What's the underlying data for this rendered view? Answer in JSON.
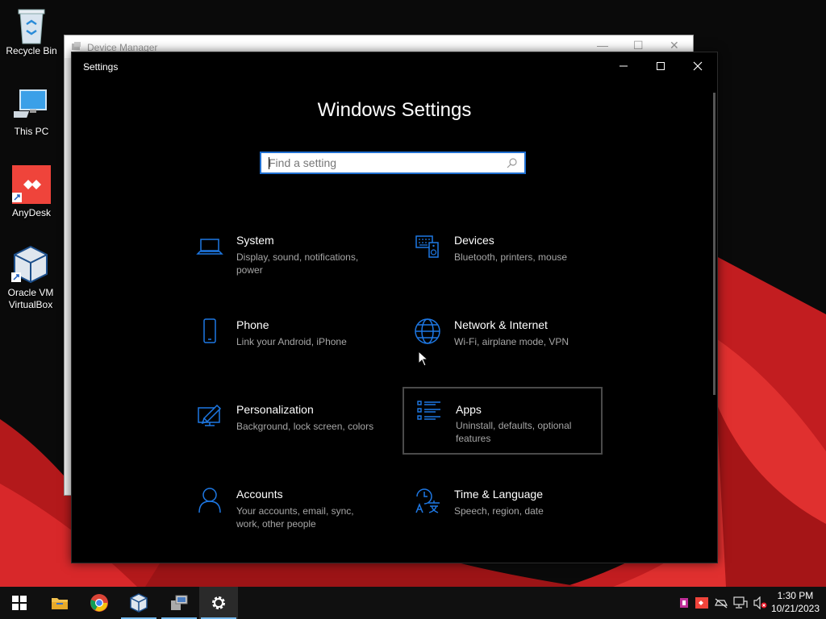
{
  "desktop": {
    "icons": [
      {
        "label": "Recycle Bin",
        "icon": "recycle-bin-icon"
      },
      {
        "label": "This PC",
        "icon": "computer-icon"
      },
      {
        "label": "AnyDesk",
        "icon": "anydesk-icon"
      },
      {
        "label": "Oracle VM VirtualBox",
        "icon": "virtualbox-icon"
      }
    ]
  },
  "device_manager": {
    "title": "Device Manager"
  },
  "settings": {
    "title": "Settings",
    "heading": "Windows Settings",
    "search": {
      "placeholder": "Find a setting",
      "value": ""
    },
    "window_controls": [
      "minimize",
      "maximize",
      "close"
    ],
    "accent": "#1e78e4",
    "categories": [
      {
        "name": "System",
        "desc": "Display, sound, notifications, power",
        "icon": "laptop-icon"
      },
      {
        "name": "Devices",
        "desc": "Bluetooth, printers, mouse",
        "icon": "keyboard-speaker-icon"
      },
      {
        "name": "Phone",
        "desc": "Link your Android, iPhone",
        "icon": "phone-icon"
      },
      {
        "name": "Network & Internet",
        "desc": "Wi-Fi, airplane mode, VPN",
        "icon": "globe-icon"
      },
      {
        "name": "Personalization",
        "desc": "Background, lock screen, colors",
        "icon": "paint-monitor-icon"
      },
      {
        "name": "Apps",
        "desc": "Uninstall, defaults, optional features",
        "icon": "apps-list-icon",
        "hovered": true
      },
      {
        "name": "Accounts",
        "desc": "Your accounts, email, sync, work, other people",
        "icon": "person-icon"
      },
      {
        "name": "Time & Language",
        "desc": "Speech, region, date",
        "icon": "time-language-icon"
      }
    ]
  },
  "taskbar": {
    "apps": [
      {
        "name": "start",
        "icon": "windows-start-icon"
      },
      {
        "name": "file-explorer",
        "icon": "folder-icon"
      },
      {
        "name": "chrome",
        "icon": "chrome-icon"
      },
      {
        "name": "virtualbox",
        "icon": "virtualbox-icon",
        "running": true
      },
      {
        "name": "device-manager",
        "icon": "device-manager-icon",
        "running": true
      },
      {
        "name": "settings",
        "icon": "gear-icon",
        "running": true,
        "active": true
      }
    ],
    "tray_icons": [
      "app-tray-icon",
      "anydesk-tray-icon",
      "network-offline-icon",
      "network-icon",
      "volume-muted-icon"
    ],
    "time": "1:30 PM",
    "date": "10/21/2023"
  }
}
